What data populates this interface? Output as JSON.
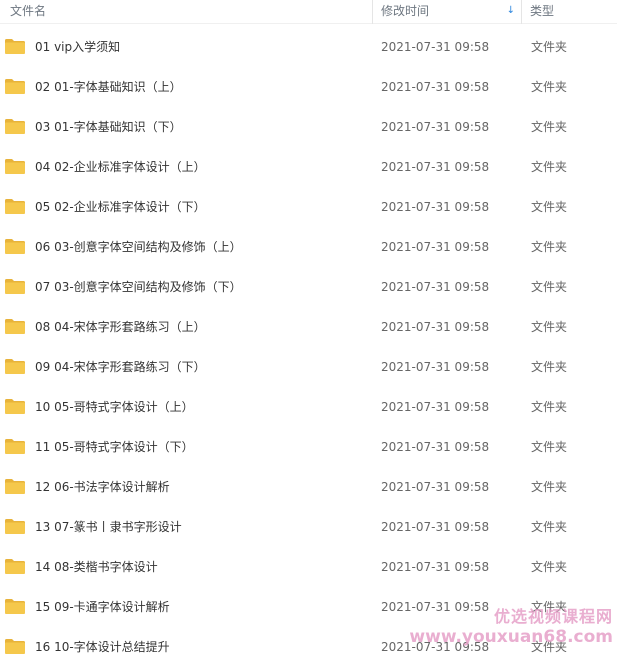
{
  "header": {
    "col_name": "文件名",
    "col_date": "修改时间",
    "col_type": "类型",
    "sort_indicator": "↓"
  },
  "colors": {
    "folder_main": "#f5c84c",
    "folder_tab": "#e8b33a",
    "sort_accent": "#2e86de",
    "watermark": "#e6a0c8"
  },
  "files": [
    {
      "name": "01 vip入学须知",
      "date": "2021-07-31 09:58",
      "type": "文件夹",
      "icon": "folder-icon"
    },
    {
      "name": "02 01-字体基础知识（上）",
      "date": "2021-07-31 09:58",
      "type": "文件夹",
      "icon": "folder-icon"
    },
    {
      "name": "03 01-字体基础知识（下）",
      "date": "2021-07-31 09:58",
      "type": "文件夹",
      "icon": "folder-icon"
    },
    {
      "name": "04 02-企业标准字体设计（上）",
      "date": "2021-07-31 09:58",
      "type": "文件夹",
      "icon": "folder-icon"
    },
    {
      "name": "05 02-企业标准字体设计（下）",
      "date": "2021-07-31 09:58",
      "type": "文件夹",
      "icon": "folder-icon"
    },
    {
      "name": "06 03-创意字体空间结构及修饰（上）",
      "date": "2021-07-31 09:58",
      "type": "文件夹",
      "icon": "folder-icon"
    },
    {
      "name": "07 03-创意字体空间结构及修饰（下）",
      "date": "2021-07-31 09:58",
      "type": "文件夹",
      "icon": "folder-icon"
    },
    {
      "name": "08 04-宋体字形套路练习（上）",
      "date": "2021-07-31 09:58",
      "type": "文件夹",
      "icon": "folder-icon"
    },
    {
      "name": "09 04-宋体字形套路练习（下）",
      "date": "2021-07-31 09:58",
      "type": "文件夹",
      "icon": "folder-icon"
    },
    {
      "name": "10 05-哥特式字体设计（上）",
      "date": "2021-07-31 09:58",
      "type": "文件夹",
      "icon": "folder-icon"
    },
    {
      "name": "11 05-哥特式字体设计（下）",
      "date": "2021-07-31 09:58",
      "type": "文件夹",
      "icon": "folder-icon"
    },
    {
      "name": "12 06-书法字体设计解析",
      "date": "2021-07-31 09:58",
      "type": "文件夹",
      "icon": "folder-icon"
    },
    {
      "name": "13 07-篆书丨隶书字形设计",
      "date": "2021-07-31 09:58",
      "type": "文件夹",
      "icon": "folder-icon"
    },
    {
      "name": "14 08-类楷书字体设计",
      "date": "2021-07-31 09:58",
      "type": "文件夹",
      "icon": "folder-icon"
    },
    {
      "name": "15 09-卡通字体设计解析",
      "date": "2021-07-31 09:58",
      "type": "文件夹",
      "icon": "folder-icon"
    },
    {
      "name": "16 10-字体设计总结提升",
      "date": "2021-07-31 09:58",
      "type": "文件夹",
      "icon": "folder-icon"
    }
  ],
  "watermark": {
    "text_cn": "优选视频课程网",
    "text_url": "www.youxuan68.com"
  }
}
